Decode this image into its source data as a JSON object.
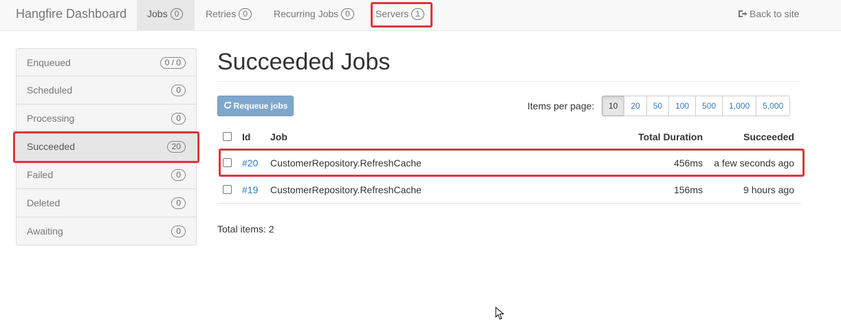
{
  "navbar": {
    "brand": "Hangfire Dashboard",
    "items": [
      {
        "label": "Jobs",
        "count": "0",
        "active": true
      },
      {
        "label": "Retries",
        "count": "0"
      },
      {
        "label": "Recurring Jobs",
        "count": "0"
      },
      {
        "label": "Servers",
        "count": "1"
      }
    ],
    "back_label": "Back to site",
    "back_icon": "sign-out-icon"
  },
  "sidebar": {
    "items": [
      {
        "label": "Enqueued",
        "count": "0 / 0"
      },
      {
        "label": "Scheduled",
        "count": "0"
      },
      {
        "label": "Processing",
        "count": "0"
      },
      {
        "label": "Succeeded",
        "count": "20",
        "active": true
      },
      {
        "label": "Failed",
        "count": "0"
      },
      {
        "label": "Deleted",
        "count": "0"
      },
      {
        "label": "Awaiting",
        "count": "0"
      }
    ]
  },
  "main": {
    "title": "Succeeded Jobs",
    "requeue_label": "Requeue jobs",
    "requeue_icon": "refresh-icon",
    "items_per_page_label": "Items per page:",
    "page_sizes": [
      "10",
      "20",
      "50",
      "100",
      "500",
      "1,000",
      "5,000"
    ],
    "selected_page_size": "10",
    "table": {
      "headers": {
        "id": "Id",
        "job": "Job",
        "duration": "Total Duration",
        "succeeded": "Succeeded"
      },
      "rows": [
        {
          "id": "#20",
          "job": "CustomerRepository.RefreshCache",
          "duration": "456ms",
          "succeeded": "a few seconds ago"
        },
        {
          "id": "#19",
          "job": "CustomerRepository.RefreshCache",
          "duration": "156ms",
          "succeeded": "9 hours ago"
        }
      ]
    },
    "total_items": "Total items: 2"
  },
  "colors": {
    "highlight": "#d9373c",
    "link": "#337ab7",
    "requeue_button": "#7fa7cc"
  }
}
